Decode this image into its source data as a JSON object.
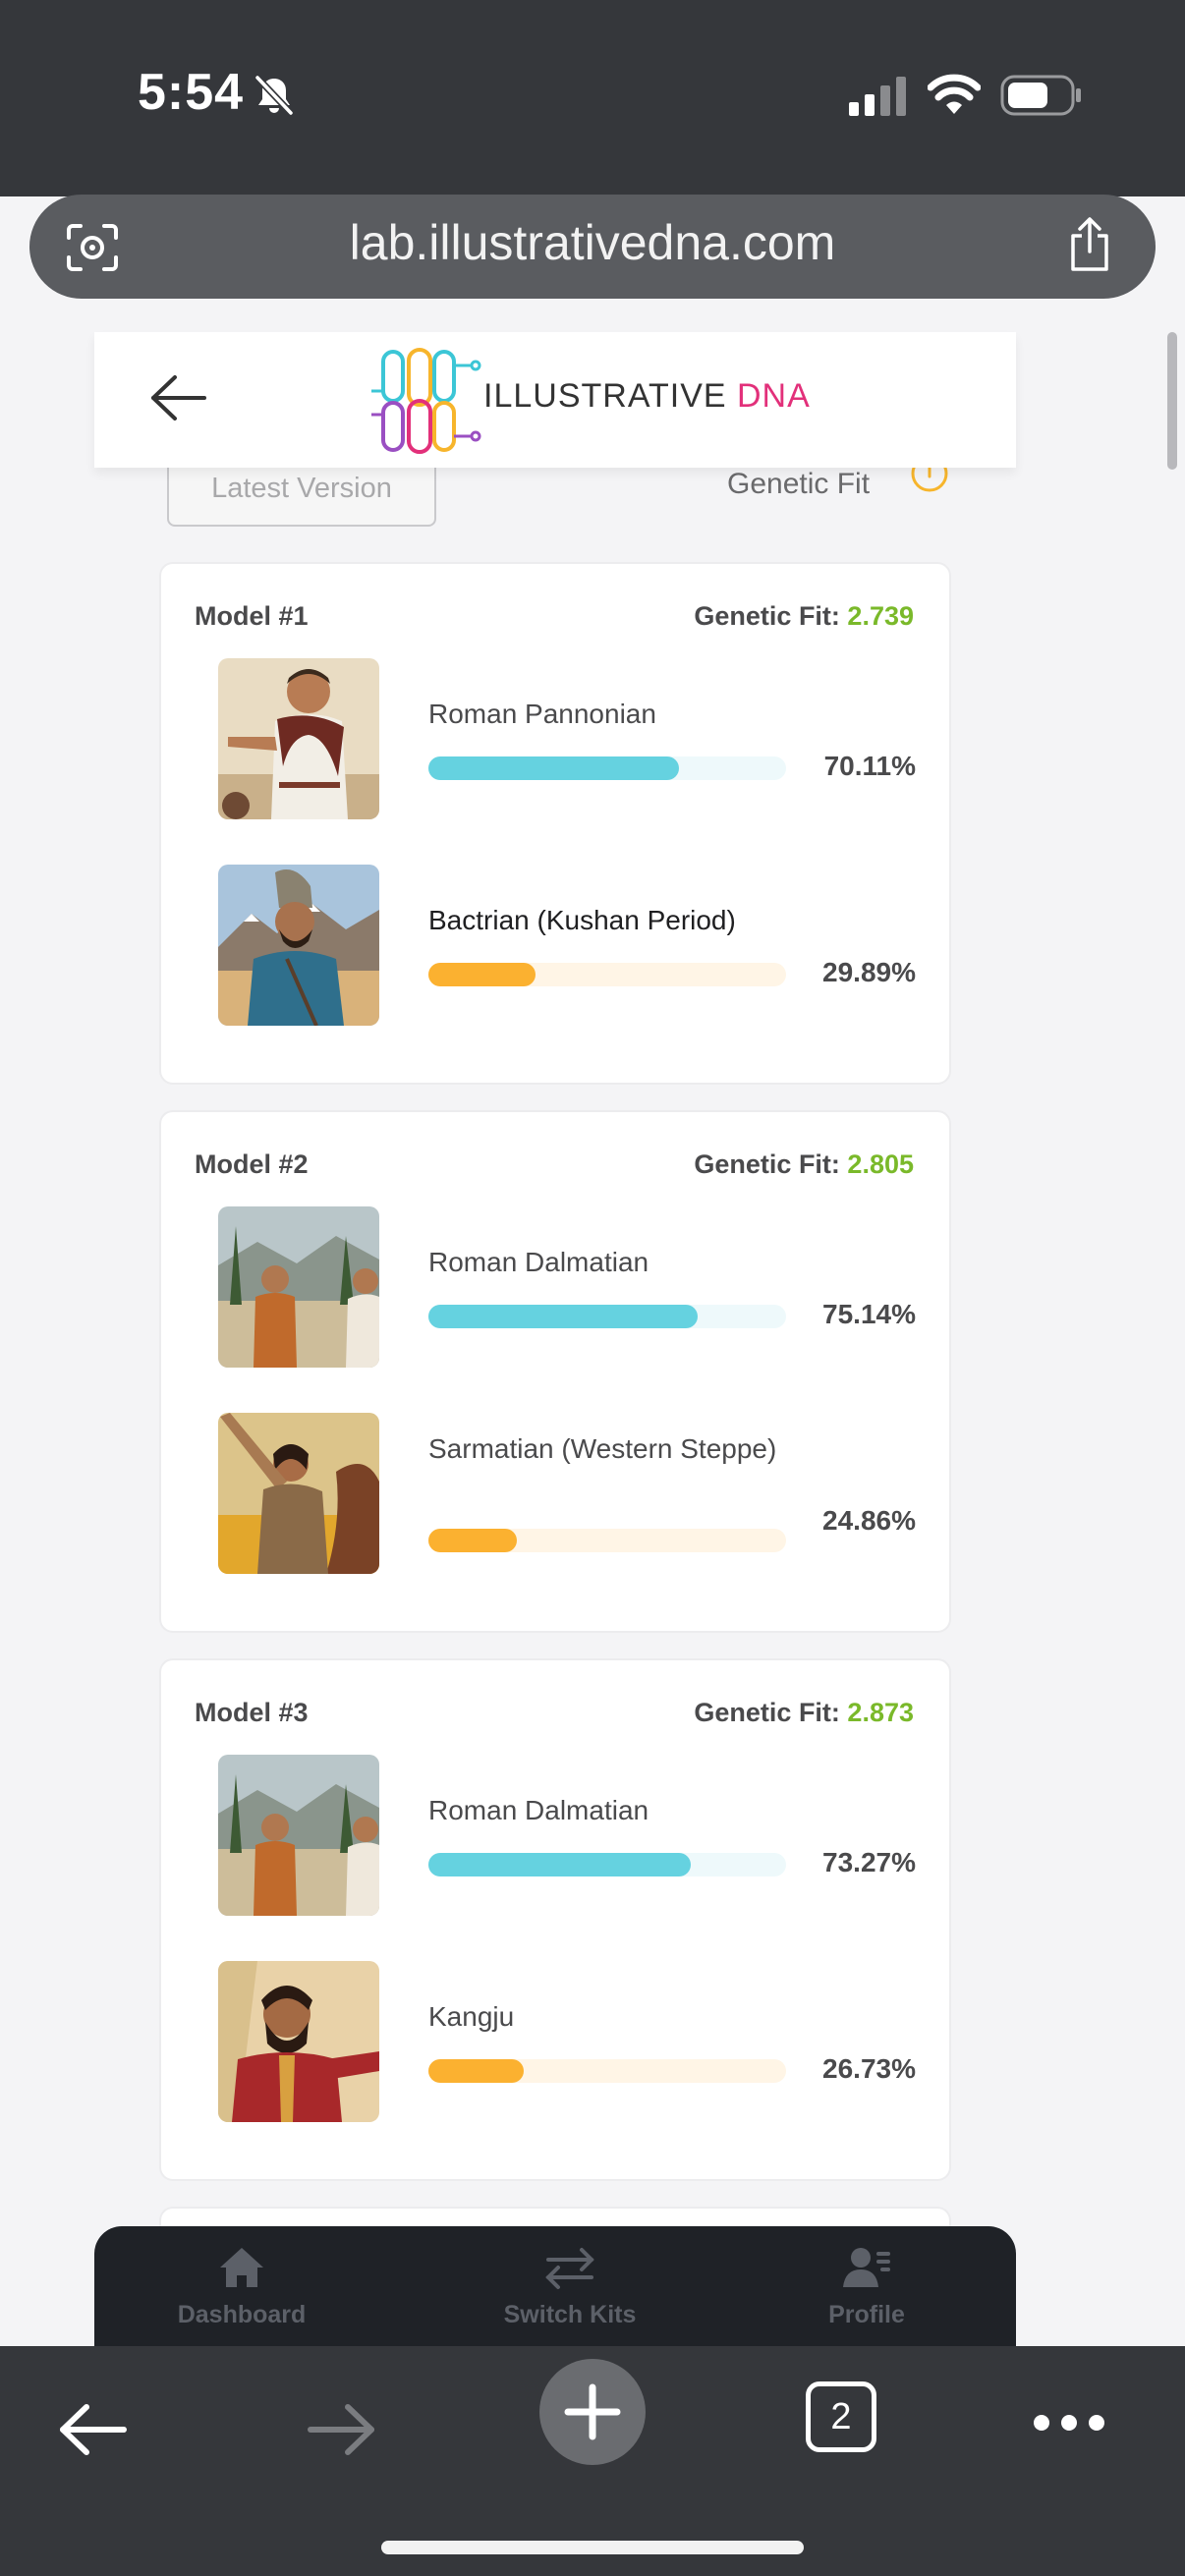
{
  "status_bar": {
    "time": "5:54"
  },
  "browser": {
    "url": "lab.illustrativedna.com",
    "tab_count": "2"
  },
  "header": {
    "logo_text_main": "ILLUSTRATIVE ",
    "logo_text_accent": "DNA"
  },
  "filters": {
    "version_label": "Latest Version",
    "sort_label": "Genetic Fit"
  },
  "fit_label": "Genetic Fit: ",
  "models": [
    {
      "title": "Model #1",
      "fit": "2.739",
      "populations": [
        {
          "name": "Roman Pannonian",
          "percent": "70.11%",
          "fraction": 0.7011
        },
        {
          "name": "Bactrian (Kushan Period)",
          "percent": "29.89%",
          "fraction": 0.2989
        }
      ]
    },
    {
      "title": "Model #2",
      "fit": "2.805",
      "populations": [
        {
          "name": "Roman Dalmatian",
          "percent": "75.14%",
          "fraction": 0.7514
        },
        {
          "name": "Sarmatian (Western Steppe)",
          "percent": "24.86%",
          "fraction": 0.2486
        }
      ]
    },
    {
      "title": "Model #3",
      "fit": "2.873",
      "populations": [
        {
          "name": "Roman Dalmatian",
          "percent": "73.27%",
          "fraction": 0.7327
        },
        {
          "name": "Kangju",
          "percent": "26.73%",
          "fraction": 0.2673
        }
      ]
    }
  ],
  "nav": {
    "dashboard": "Dashboard",
    "switch_kits": "Switch Kits",
    "profile": "Profile"
  },
  "colors": {
    "primary_bar": "#65d2e0",
    "secondary_bar": "#fbb130",
    "fit_value": "#7ab92a"
  }
}
